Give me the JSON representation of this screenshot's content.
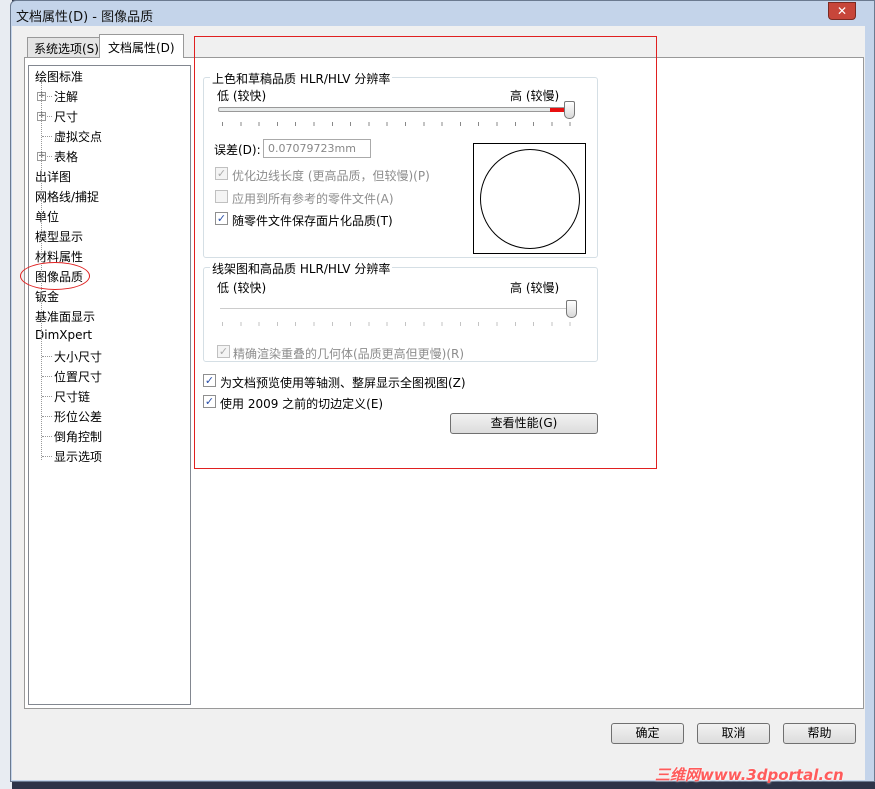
{
  "window": {
    "title": "文档属性(D) - 图像品质",
    "close": "✕"
  },
  "tabs": [
    {
      "label": "系统选项(S)",
      "active": false
    },
    {
      "label": "文档属性(D)",
      "active": true
    }
  ],
  "tree": [
    {
      "label": "绘图标准",
      "level": 0
    },
    {
      "label": "注解",
      "level": 1,
      "expand": "+"
    },
    {
      "label": "尺寸",
      "level": 1,
      "expand": "+"
    },
    {
      "label": "虚拟交点",
      "level": 1
    },
    {
      "label": "表格",
      "level": 1,
      "expand": "+"
    },
    {
      "label": "出详图",
      "level": 0
    },
    {
      "label": "网格线/捕捉",
      "level": 0
    },
    {
      "label": "单位",
      "level": 0
    },
    {
      "label": "模型显示",
      "level": 0
    },
    {
      "label": "材料属性",
      "level": 0
    },
    {
      "label": "图像品质",
      "level": 0,
      "selected": true
    },
    {
      "label": "钣金",
      "level": 0
    },
    {
      "label": "基准面显示",
      "level": 0
    },
    {
      "label": "DimXpert",
      "level": 0
    },
    {
      "label": "大小尺寸",
      "level": 1
    },
    {
      "label": "位置尺寸",
      "level": 1
    },
    {
      "label": "尺寸链",
      "level": 1
    },
    {
      "label": "形位公差",
      "level": 1
    },
    {
      "label": "倒角控制",
      "level": 1
    },
    {
      "label": "显示选项",
      "level": 1
    }
  ],
  "shaded": {
    "title": "上色和草稿品质 HLR/HLV 分辨率",
    "low": "低 (较快)",
    "high": "高 (较慢)",
    "slider_value": 1.0,
    "deviation_label": "误差(D):",
    "deviation_value": "0.07079723mm",
    "optimize": {
      "label": "优化边线长度 (更高品质，但较慢)(P)",
      "checked": true,
      "disabled": true
    },
    "apply_all": {
      "label": "应用到所有参考的零件文件(A)",
      "checked": false,
      "disabled": true
    },
    "save_tess": {
      "label": "随零件文件保存面片化品质(T)",
      "checked": true,
      "disabled": false
    }
  },
  "wireframe": {
    "title": "线架图和高品质 HLR/HLV 分辨率",
    "low": "低 (较快)",
    "high": "高 (较慢)",
    "slider_value": 1.0,
    "precise": {
      "label": "精确渲染重叠的几何体(品质更高但更慢)(R)",
      "checked": true,
      "disabled": true
    }
  },
  "iso_preview": {
    "label": "为文档预览使用等轴测、整屏显示全图视图(Z)",
    "checked": true
  },
  "pre2009": {
    "label": "使用 2009 之前的切边定义(E)",
    "checked": true
  },
  "perf_button": "查看性能(G)",
  "buttons": {
    "ok": "确定",
    "cancel": "取消",
    "help": "帮助"
  },
  "watermark": "三维网www.3dportal.cn",
  "colors": {
    "highlight": "#e02020"
  }
}
